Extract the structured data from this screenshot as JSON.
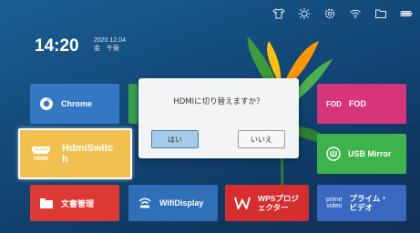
{
  "status_bar": {
    "icons": [
      "shirt-icon",
      "brightness-icon",
      "settings-icon",
      "wifi-icon",
      "folder-icon",
      "battery-icon"
    ]
  },
  "clock": {
    "time": "14:20",
    "date": "2020.12.04",
    "weekday_ampm": "金　午後"
  },
  "tiles": {
    "chrome": {
      "label": "Chrome",
      "color": "#3478c4"
    },
    "fod": {
      "label": "FOD",
      "icon_text": "FOD",
      "color": "#d7357a"
    },
    "hdmi": {
      "label_line1": "HdmiSwitc",
      "label_line2": "h",
      "icon_text": "HDMI",
      "color": "#f1c04e"
    },
    "usb_mirror": {
      "label": "USB Mirror",
      "color": "#3fb34b"
    },
    "files": {
      "label": "文書管理",
      "color": "#de3a34"
    },
    "wifi_display": {
      "label": "WifiDisplay",
      "color": "#2f6fb8"
    },
    "wps": {
      "label_line1": "WPSプロジ",
      "label_line2": "ェクター",
      "color": "#d62e2e"
    },
    "prime": {
      "label_line1": "プライム・",
      "label_line2": "ビデオ",
      "icon_top": "prime",
      "icon_bottom": "video",
      "color": "#3a67c0"
    }
  },
  "dialog": {
    "message": "HDMIに切り替えますか？",
    "yes_label": "はい",
    "no_label": "いいえ"
  }
}
